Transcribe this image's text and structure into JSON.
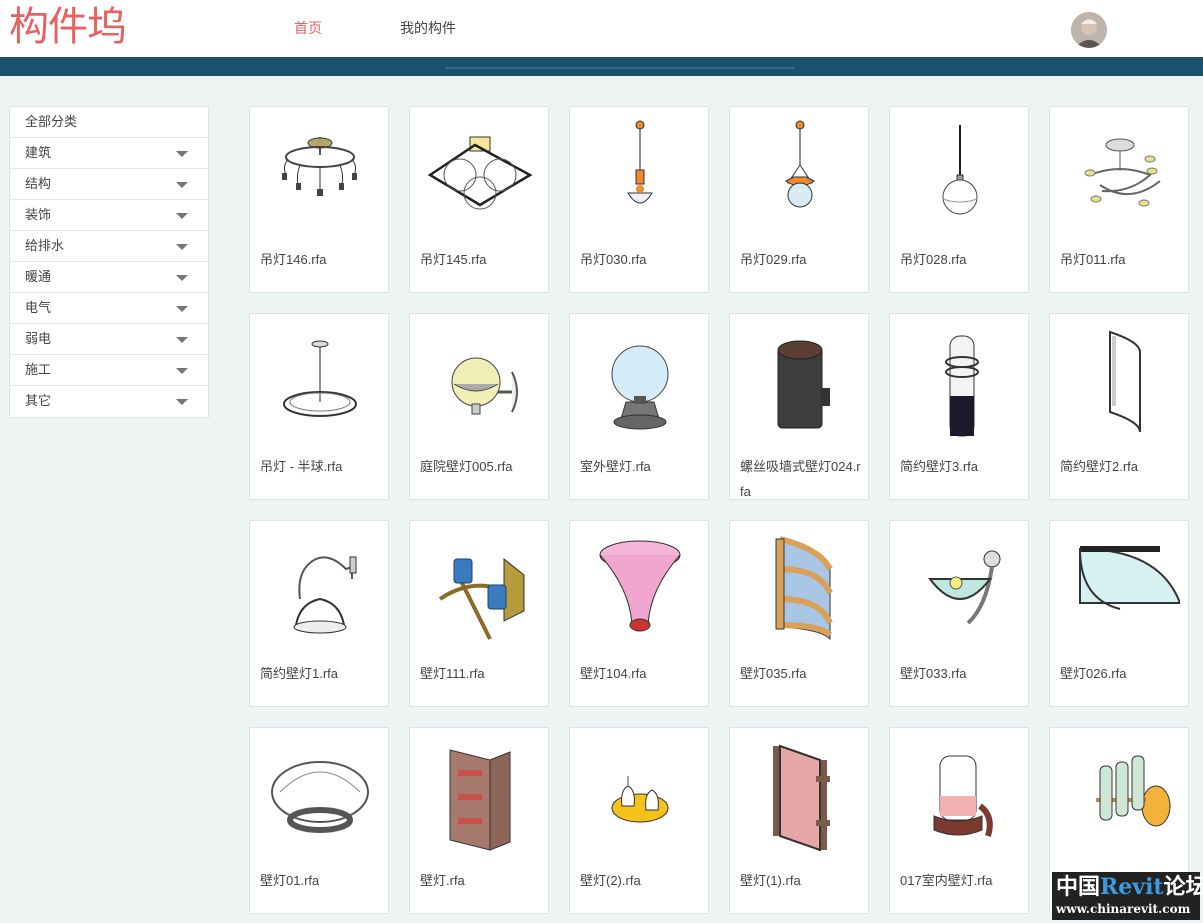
{
  "header": {
    "logo": "构件坞",
    "nav": {
      "home": "首页",
      "my_components": "我的构件"
    }
  },
  "colors": {
    "accent": "#e8605f",
    "banner": "#19526a"
  },
  "sidebar": {
    "all": "全部分类",
    "items": [
      "建筑",
      "结构",
      "装饰",
      "给排水",
      "暖通",
      "电气",
      "弱电",
      "施工",
      "其它"
    ]
  },
  "items": [
    {
      "name": "吊灯146.rfa",
      "icon": "chandelier-icon"
    },
    {
      "name": "吊灯145.rfa",
      "icon": "ceiling-globe-lamp-icon"
    },
    {
      "name": "吊灯030.rfa",
      "icon": "pendant-lamp-icon"
    },
    {
      "name": "吊灯029.rfa",
      "icon": "pendant-lamp-icon"
    },
    {
      "name": "吊灯028.rfa",
      "icon": "globe-pendant-icon"
    },
    {
      "name": "吊灯011.rfa",
      "icon": "branch-chandelier-icon"
    },
    {
      "name": "吊灯 - 半球.rfa",
      "icon": "hemisphere-pendant-icon"
    },
    {
      "name": "庭院壁灯005.rfa",
      "icon": "garden-wall-lamp-icon"
    },
    {
      "name": "室外壁灯.rfa",
      "icon": "outdoor-lamp-icon"
    },
    {
      "name": "螺丝吸墙式壁灯024.rfa",
      "icon": "cylinder-wall-lamp-icon"
    },
    {
      "name": "简约壁灯3.rfa",
      "icon": "tube-lamp-icon"
    },
    {
      "name": "简约壁灯2.rfa",
      "icon": "half-tube-lamp-icon"
    },
    {
      "name": "简约壁灯1.rfa",
      "icon": "bell-wall-lamp-icon"
    },
    {
      "name": "壁灯111.rfa",
      "icon": "double-arm-wall-lamp-icon"
    },
    {
      "name": "壁灯104.rfa",
      "icon": "trumpet-lamp-icon"
    },
    {
      "name": "壁灯035.rfa",
      "icon": "framed-wall-lamp-icon"
    },
    {
      "name": "壁灯033.rfa",
      "icon": "bowl-wall-lamp-icon"
    },
    {
      "name": "壁灯026.rfa",
      "icon": "half-bowl-lamp-icon"
    },
    {
      "name": "壁灯01.rfa",
      "icon": "ring-lamp-icon"
    },
    {
      "name": "壁灯.rfa",
      "icon": "brick-wall-lamp-icon"
    },
    {
      "name": "壁灯(2).rfa",
      "icon": "twin-candle-lamp-icon"
    },
    {
      "name": "壁灯(1).rfa",
      "icon": "panel-wall-lamp-icon"
    },
    {
      "name": "017室内壁灯.rfa",
      "icon": "lantern-wall-lamp-icon"
    },
    {
      "name": "",
      "icon": "triple-tube-lamp-icon"
    }
  ],
  "watermark": {
    "line1_a": "中国",
    "line1_b": "Revit",
    "line1_c": "论坛",
    "line2": "www.chinarevit.com"
  }
}
